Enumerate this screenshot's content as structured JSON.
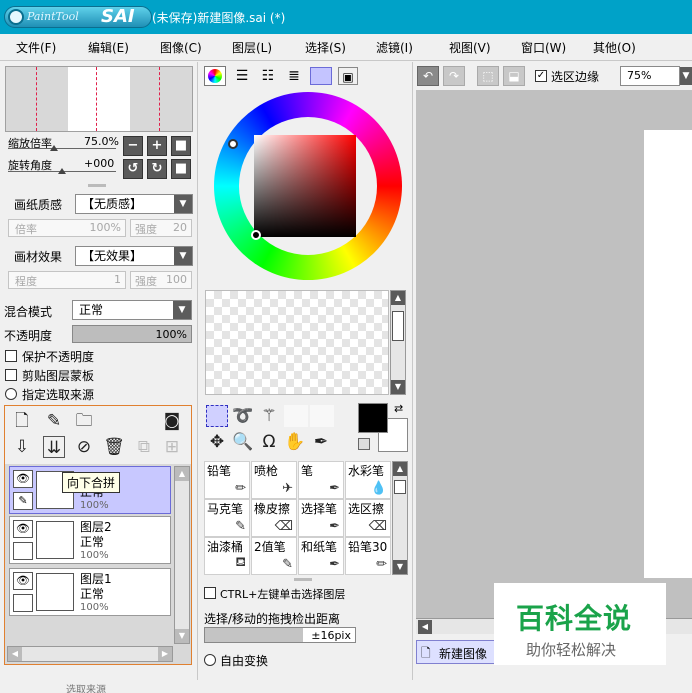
{
  "app": {
    "logo_text": "PaintTool",
    "logo_sai": "SAI",
    "window_title": "(未保存)新建图像.sai (*)"
  },
  "menu": [
    "文件(F)",
    "编辑(E)",
    "图像(C)",
    "图层(L)",
    "选择(S)",
    "滤镜(I)",
    "视图(V)",
    "窗口(W)",
    "其他(O)"
  ],
  "navigator": {
    "zoom_label": "缩放倍率",
    "zoom_value": "75.0%",
    "rotate_label": "旋转角度",
    "rotate_value": "+000"
  },
  "texture": {
    "paper_label": "画纸质感",
    "paper_value": "【无质感】",
    "paper_scale_label": "倍率",
    "paper_scale_value": "100%",
    "paper_strength_label": "强度",
    "paper_strength_value": "20",
    "effect_label": "画材效果",
    "effect_value": "【无效果】",
    "effect_degree_label": "程度",
    "effect_degree_value": "1",
    "effect_strength_label": "强度",
    "effect_strength_value": "100"
  },
  "layer_props": {
    "blend_label": "混合模式",
    "blend_value": "正常",
    "opacity_label": "不透明度",
    "opacity_value": "100%",
    "opacity_level": 1.0,
    "protect_opacity": "保护不透明度",
    "clip_mask": "剪贴图层蒙板",
    "selection_source": "指定选取来源"
  },
  "layers": {
    "tooltip": "向下合拼",
    "items": [
      {
        "name": "",
        "mode": "正常",
        "opacity": "100%",
        "selected": true
      },
      {
        "name": "图层2",
        "mode": "正常",
        "opacity": "100%",
        "selected": false
      },
      {
        "name": "图层1",
        "mode": "正常",
        "opacity": "100%",
        "selected": false
      }
    ]
  },
  "color": {
    "primary": "#000000",
    "secondary": "#ffffff"
  },
  "brushes": [
    {
      "name": "铅笔"
    },
    {
      "name": "喷枪"
    },
    {
      "name": "笔"
    },
    {
      "name": "水彩笔"
    },
    {
      "name": "马克笔"
    },
    {
      "name": "橡皮擦"
    },
    {
      "name": "选择笔"
    },
    {
      "name": "选区擦"
    },
    {
      "name": "油漆桶"
    },
    {
      "name": "2值笔"
    },
    {
      "name": "和纸笔"
    },
    {
      "name": "铅笔30"
    }
  ],
  "tool_options": {
    "ctrl_select": "CTRL+左键单击选择图层",
    "drag_distance_label": "选择/移动的拖拽检出距离",
    "drag_distance_value": "±16pix",
    "free_transform": "自由变换"
  },
  "canvas_toolbar": {
    "selection_edge": "选区边缘",
    "zoom": "75%"
  },
  "document_tab": "新建图像",
  "watermark": {
    "title": "百科全说",
    "subtitle": "助你轻松解决"
  },
  "bottom_text": "选取来源"
}
